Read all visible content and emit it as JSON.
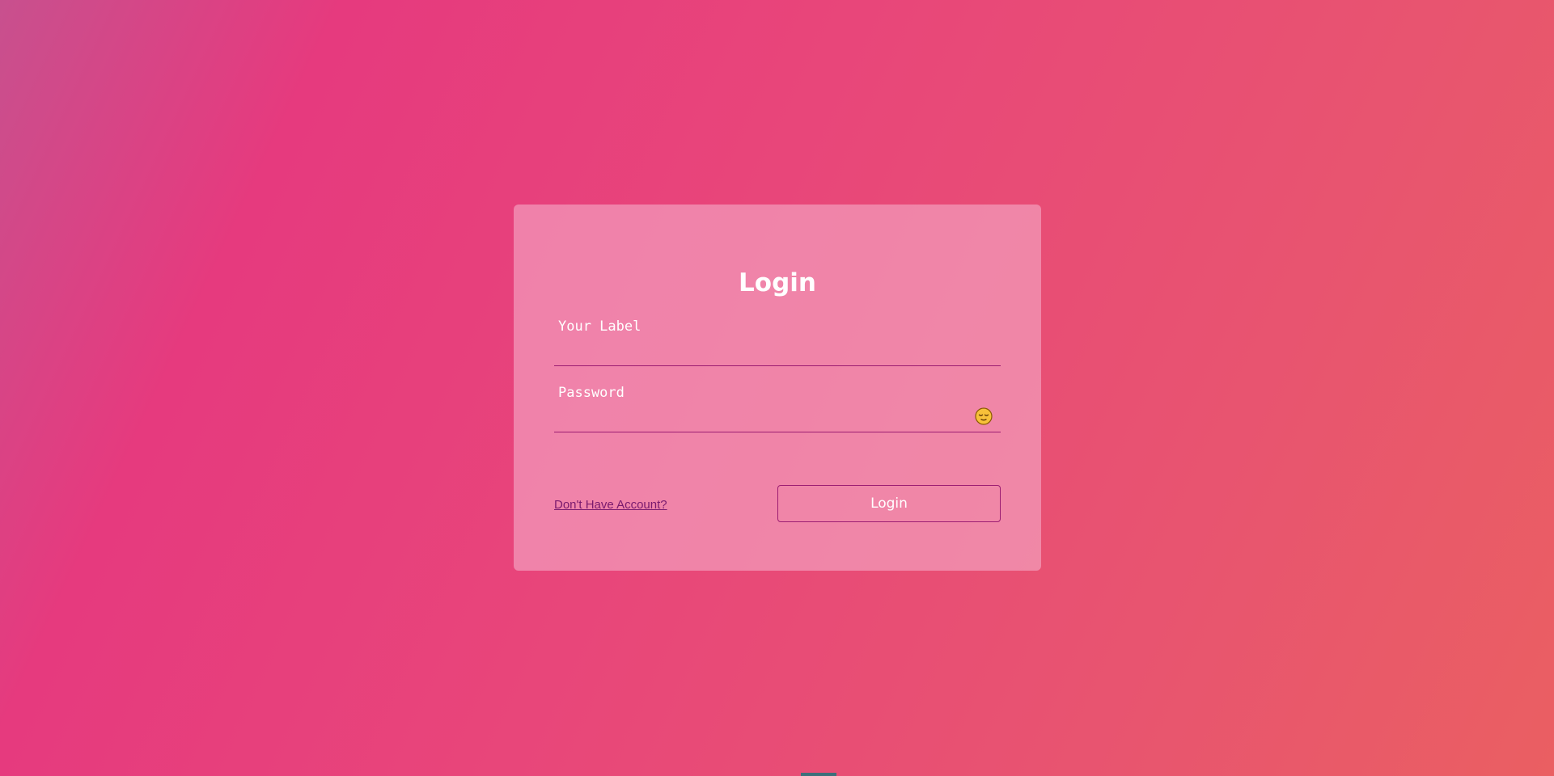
{
  "login_card": {
    "title": "Login",
    "username": {
      "label": "Your Label",
      "value": ""
    },
    "password": {
      "label": "Password",
      "value": "",
      "toggle_icon": "sleepy-face-emoji-icon"
    },
    "signup_link": "Don't Have Account?",
    "submit_label": "Login"
  },
  "colors": {
    "background_start": "#c8508e",
    "background_end": "#ea5f62",
    "card": "#f082a2",
    "underline": "#9b1c72",
    "link": "#7a1a6e"
  }
}
